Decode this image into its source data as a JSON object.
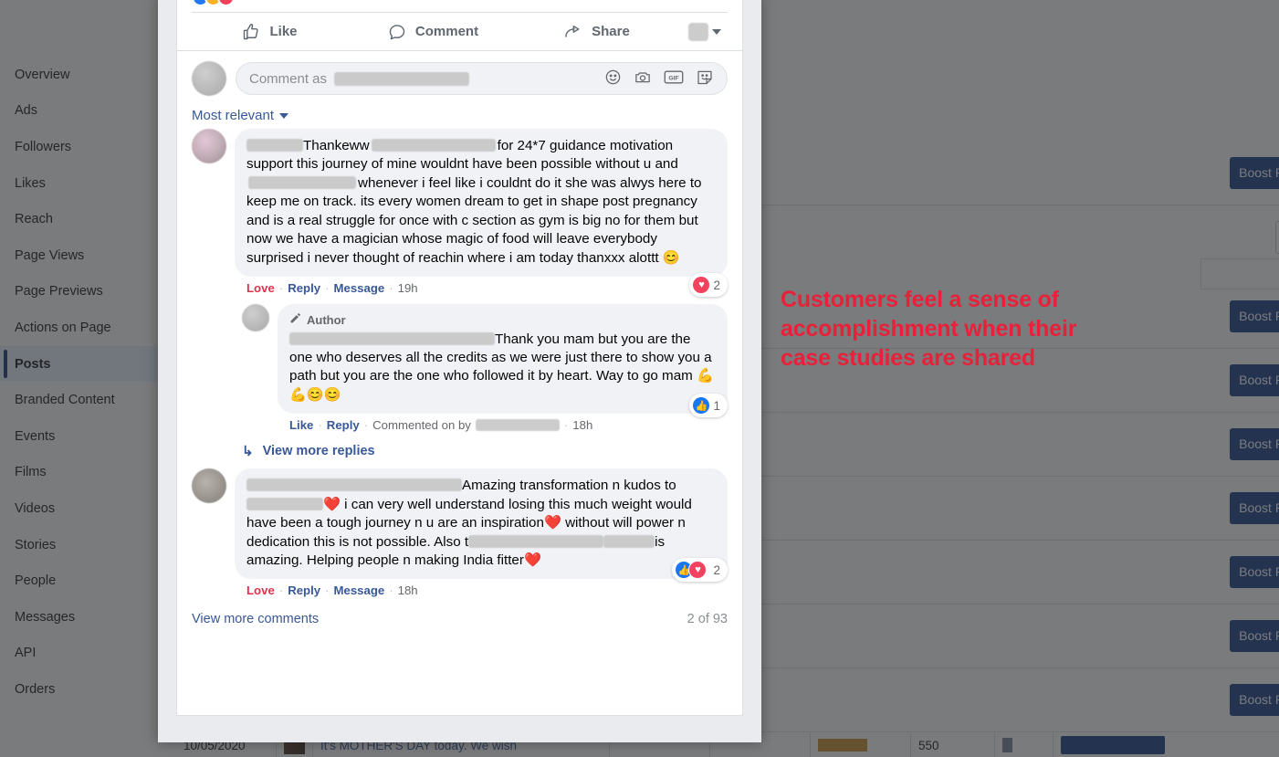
{
  "background": {
    "sidebar": {
      "items": [
        {
          "label": "Overview",
          "active": false
        },
        {
          "label": "Ads",
          "active": false
        },
        {
          "label": "Followers",
          "active": false
        },
        {
          "label": "Likes",
          "active": false
        },
        {
          "label": "Reach",
          "active": false
        },
        {
          "label": "Page Views",
          "active": false
        },
        {
          "label": "Page Previews",
          "active": false
        },
        {
          "label": "Actions on Page",
          "active": false
        },
        {
          "label": "Posts",
          "active": true
        },
        {
          "label": "Branded Content",
          "active": false
        },
        {
          "label": "Events",
          "active": false
        },
        {
          "label": "Films",
          "active": false
        },
        {
          "label": "Videos",
          "active": false
        },
        {
          "label": "Stories",
          "active": false
        },
        {
          "label": "People",
          "active": false
        },
        {
          "label": "Messages",
          "active": false
        },
        {
          "label": "API",
          "active": false
        },
        {
          "label": "Orders",
          "active": false
        }
      ]
    },
    "boost_button_label": "Boost Post",
    "boost_button_visible_text": "ost",
    "bottom_row": {
      "date": "10/05/2020",
      "post_text": "It's MOTHER'S DAY today. We wish",
      "reach": "550"
    }
  },
  "modal": {
    "reactions_summary": {
      "icons": [
        "like-reaction-icon",
        "haha-reaction-icon",
        "love-reaction-icon"
      ]
    },
    "actions": [
      {
        "name": "like",
        "label": "Like",
        "icon": "thumbs-up-icon"
      },
      {
        "name": "comment",
        "label": "Comment",
        "icon": "comment-bubble-icon"
      },
      {
        "name": "share",
        "label": "Share",
        "icon": "share-arrow-icon"
      }
    ],
    "composer": {
      "prefix": "Comment as",
      "redacted_name": true,
      "icons": [
        "emoji-icon",
        "camera-icon",
        "gif-icon",
        "sticker-icon"
      ]
    },
    "sort": {
      "label": "Most relevant"
    },
    "comments": [
      {
        "id": "comment-1",
        "author_redacted": true,
        "text": "Thankeww",
        "text_continued": "for 24*7 guidance motivation support this journey of mine wouldnt have been possible without u and",
        "text_continued_2": "whenever i feel like i couldnt do it she was alwys here to keep me on track. its every women dream to get in shape post pregnancy and is a real struggle for once with c section as gym is big no for them but now we have a magician whose magic of food will leave everybody surprised i never thought of reachin where i am today thanxxx alottt",
        "emoji": "😊",
        "reaction": {
          "icons": [
            "love"
          ],
          "count": "2"
        },
        "meta": {
          "reaction_label": "Love",
          "reply_label": "Reply",
          "message_label": "Message",
          "time": "19h"
        }
      },
      {
        "id": "comment-1-reply-1",
        "is_reply": true,
        "author_badge": "Author",
        "author_badge_icon": "pen-icon",
        "mention_redacted": true,
        "text": "Thank you mam but you are the one who deserves all the credits as we were just there to show you a path but you are the one who followed it by heart. Way to go mam",
        "emoji": "💪💪😊😊",
        "reaction": {
          "icons": [
            "like"
          ],
          "count": "1"
        },
        "meta": {
          "reaction_label": "Like",
          "reply_label": "Reply",
          "commented_on_by_label": "Commented on by",
          "commenter_redacted": true,
          "time": "18h"
        }
      },
      {
        "id": "view-more-replies",
        "is_view_more_replies": true,
        "label": "View more replies"
      },
      {
        "id": "comment-2",
        "author_redacted": true,
        "text": "Amazing transformation n kudos to",
        "text_continued": "",
        "emoji_inline": "❤️",
        "text_continued_2": "i can very well understand losing this much weight would have been a tough journey n u are an inspiration",
        "emoji_inline_2": "❤️",
        "text_continued_3": "without will power n dedication this is not possible. Also t",
        "text_continued_4": "is amazing. Helping people n making India fitter",
        "emoji_inline_3": "❤️",
        "reaction": {
          "icons": [
            "like",
            "love"
          ],
          "count": "2"
        },
        "meta": {
          "reaction_label": "Love",
          "reply_label": "Reply",
          "message_label": "Message",
          "time": "18h"
        }
      }
    ],
    "footer": {
      "view_more_label": "View more comments",
      "count_label": "2 of 93"
    }
  },
  "annotation": {
    "text": "Customers feel a sense of accomplishment when their case studies are shared",
    "color": "#e8203a"
  }
}
